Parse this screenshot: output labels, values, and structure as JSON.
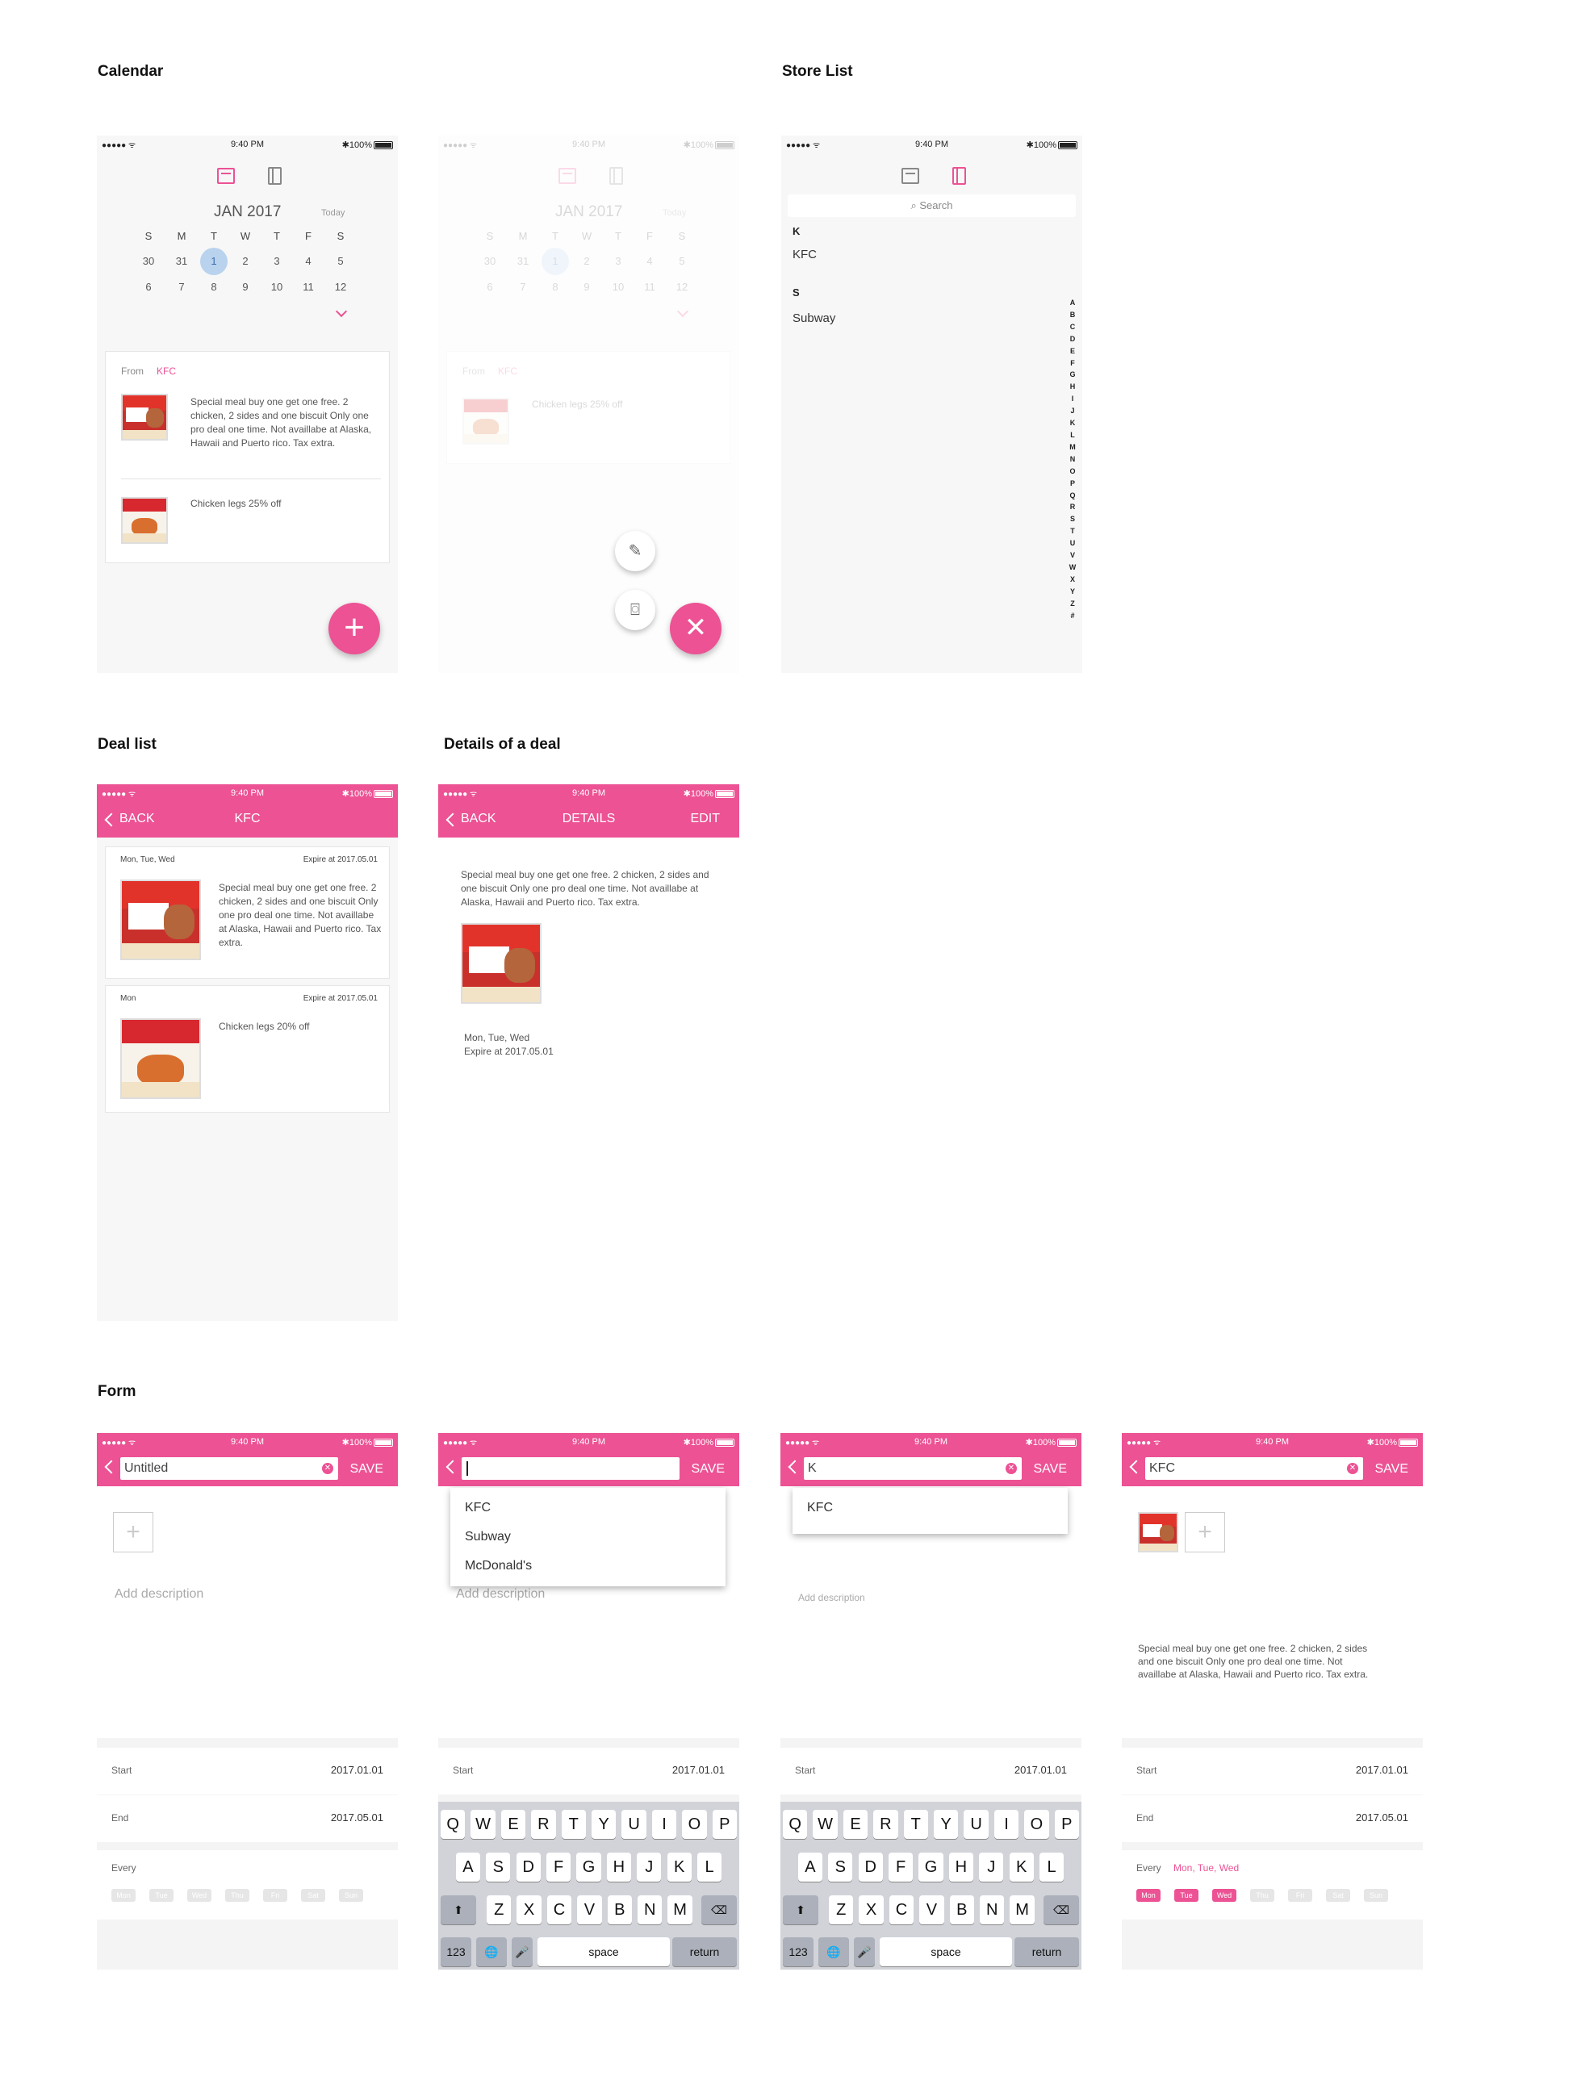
{
  "sections": {
    "calendar": "Calendar",
    "store_list": "Store List",
    "deal_list": "Deal list",
    "details": "Details of a deal",
    "form": "Form"
  },
  "status": {
    "signal": "●●●●● ᯤ",
    "time": "9:40 PM",
    "battery": "✱100%"
  },
  "calendar": {
    "month": "JAN 2017",
    "today": "Today",
    "weekdays": [
      "S",
      "M",
      "T",
      "W",
      "T",
      "F",
      "S"
    ],
    "week1": [
      "30",
      "31",
      "1",
      "2",
      "3",
      "4",
      "5"
    ],
    "week2": [
      "6",
      "7",
      "8",
      "9",
      "10",
      "11",
      "12"
    ],
    "from_label": "From",
    "from_store": "KFC",
    "deal1": "Special meal buy one get one free. 2 chicken, 2 sides and one biscuit Only one pro deal one time. Not availlabe at Alaska, Hawaii and Puerto rico. Tax extra.",
    "deal2": "Chicken legs 25% off",
    "fab": "+",
    "fab_close": "✕",
    "note_icon": "✎",
    "camera_icon": "⌼"
  },
  "store_list": {
    "search": "⌕ Search",
    "group_k": "K",
    "item_kfc": "KFC",
    "group_s": "S",
    "item_subway": "Subway",
    "alphabet": [
      "A",
      "B",
      "C",
      "D",
      "E",
      "F",
      "G",
      "H",
      "I",
      "J",
      "K",
      "L",
      "M",
      "N",
      "O",
      "P",
      "Q",
      "R",
      "S",
      "T",
      "U",
      "V",
      "W",
      "X",
      "Y",
      "Z",
      "#"
    ]
  },
  "deal_list": {
    "back": "BACK",
    "title": "KFC",
    "card1": {
      "days": "Mon, Tue, Wed",
      "expire": "Expire at 2017.05.01",
      "text": "Special meal buy one get one free. 2 chicken, 2 sides and one biscuit Only one pro deal one time. Not availlabe at Alaska, Hawaii and Puerto rico. Tax extra."
    },
    "card2": {
      "days": "Mon",
      "expire": "Expire at 2017.05.01",
      "text": "Chicken legs 20% off"
    }
  },
  "details": {
    "back": "BACK",
    "title": "DETAILS",
    "edit": "EDIT",
    "text": "Special meal buy one get one free. 2 chicken, 2 sides and one biscuit Only one pro deal one time. Not availlabe at Alaska, Hawaii and Puerto rico. Tax extra.",
    "days": "Mon, Tue, Wed",
    "expire": "Expire at 2017.05.01"
  },
  "form": {
    "save": "SAVE",
    "clear": "✕",
    "add": "+",
    "f1_value": "Untitled",
    "f3_value": "K",
    "f4_value": "KFC",
    "add_description": "Add description",
    "start_label": "Start",
    "start_value": "2017.01.01",
    "end_label": "End",
    "end_value": "2017.05.01",
    "every_label": "Every",
    "every_selected": "Mon, Tue, Wed",
    "days": [
      "Mon",
      "Tue",
      "Wed",
      "Thu",
      "Fri",
      "Sat",
      "Sun"
    ],
    "dropdown": [
      "KFC",
      "Subway",
      "McDonald's"
    ],
    "dropdown_filtered": [
      "KFC"
    ],
    "f4_desc": "Special meal buy one get one free. 2 chicken, 2 sides and one biscuit Only one pro deal one time. Not availlabe at Alaska, Hawaii and Puerto rico. Tax extra."
  },
  "keyboard": {
    "row1": [
      "Q",
      "W",
      "E",
      "R",
      "T",
      "Y",
      "U",
      "I",
      "O",
      "P"
    ],
    "row2": [
      "A",
      "S",
      "D",
      "F",
      "G",
      "H",
      "J",
      "K",
      "L"
    ],
    "row3": [
      "Z",
      "X",
      "C",
      "V",
      "B",
      "N",
      "M"
    ],
    "shift": "⬆",
    "delete": "⌫",
    "num": "123",
    "globe": "🌐",
    "mic": "🎤",
    "space": "space",
    "return": "return"
  },
  "colors": {
    "accent": "#ec5294",
    "selected_day": "#b9d3ee"
  }
}
